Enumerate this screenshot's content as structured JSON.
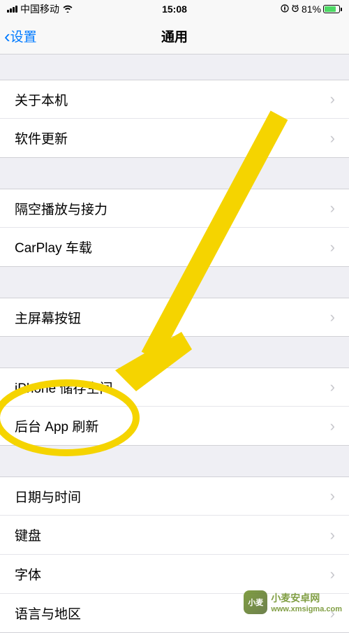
{
  "statusBar": {
    "carrier": "中国移动",
    "time": "15:08",
    "batteryPercent": "81%"
  },
  "nav": {
    "back": "设置",
    "title": "通用"
  },
  "groups": [
    {
      "items": [
        {
          "key": "about",
          "label": "关于本机"
        },
        {
          "key": "software-update",
          "label": "软件更新"
        }
      ]
    },
    {
      "items": [
        {
          "key": "airplay",
          "label": "隔空播放与接力"
        },
        {
          "key": "carplay",
          "label": "CarPlay 车载"
        }
      ]
    },
    {
      "items": [
        {
          "key": "home-button",
          "label": "主屏幕按钮"
        }
      ]
    },
    {
      "items": [
        {
          "key": "iphone-storage",
          "label": "iPhone 储存空间"
        },
        {
          "key": "background-app-refresh",
          "label": "后台 App 刷新"
        }
      ]
    },
    {
      "items": [
        {
          "key": "date-time",
          "label": "日期与时间"
        },
        {
          "key": "keyboard",
          "label": "键盘"
        },
        {
          "key": "fonts",
          "label": "字体"
        },
        {
          "key": "language-region",
          "label": "语言与地区"
        }
      ]
    }
  ],
  "annotation": {
    "highlightedItem": "后台 App 刷新"
  },
  "watermark": {
    "siteName": "小麦安卓网",
    "url": "www.xmsigma.com",
    "iconText": "小麦"
  }
}
